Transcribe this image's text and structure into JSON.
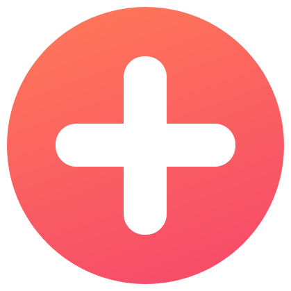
{
  "add_button": {
    "icon": "plus-icon",
    "colors": {
      "gradient_start": "#ff7a58",
      "gradient_end": "#f5476b",
      "icon": "#ffffff"
    }
  }
}
